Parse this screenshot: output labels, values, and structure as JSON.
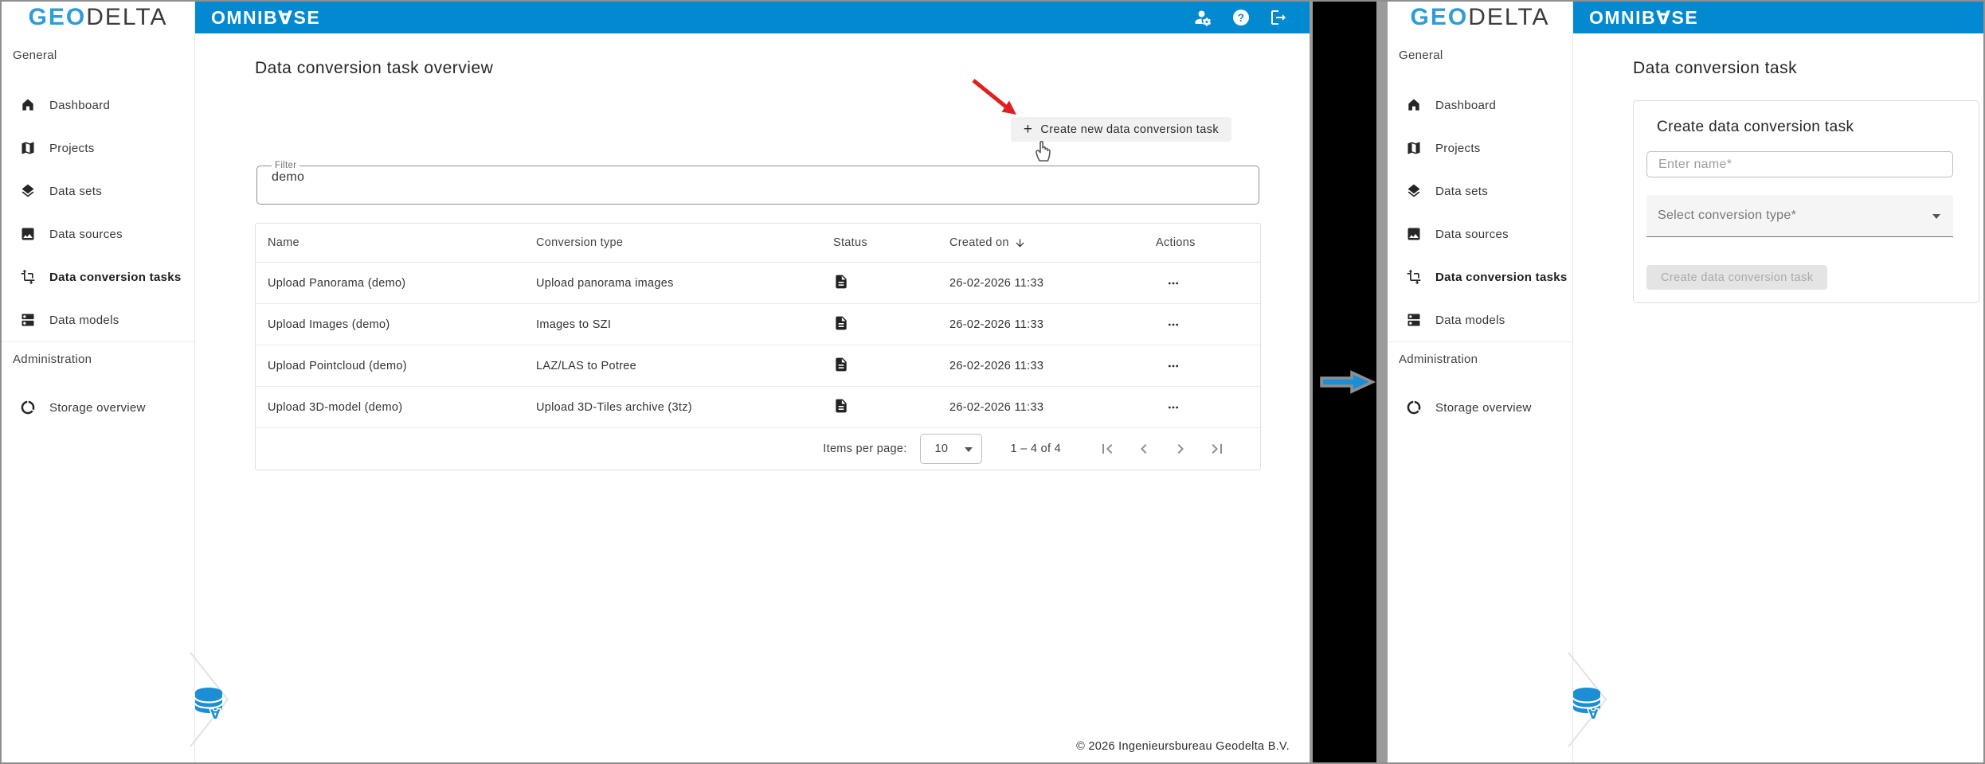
{
  "brand": {
    "logo_geo": "GEO",
    "logo_delta": "DELTA",
    "app_pre": "OMNIB",
    "app_a": "∀",
    "app_post": "SE",
    "colors": {
      "topbar_blue": "#0289d0",
      "logo_blue": "#2d9dd8",
      "accent_blue": "#1b8ed6",
      "annotation_red": "#e02020"
    }
  },
  "sidebar": {
    "section_general": "General",
    "section_admin": "Administration",
    "items": [
      {
        "label": "Dashboard",
        "icon": "home-icon"
      },
      {
        "label": "Projects",
        "icon": "map-icon"
      },
      {
        "label": "Data sets",
        "icon": "layers-icon"
      },
      {
        "label": "Data sources",
        "icon": "image-icon"
      },
      {
        "label": "Data conversion tasks",
        "icon": "transform-icon",
        "active": true
      },
      {
        "label": "Data models",
        "icon": "dns-icon"
      }
    ],
    "admin_items": [
      {
        "label": "Storage overview",
        "icon": "data-usage-icon"
      }
    ]
  },
  "topbar": {
    "icons": [
      "manage-accounts-icon",
      "help-icon",
      "logout-icon"
    ]
  },
  "left_panel": {
    "title": "Data conversion task overview",
    "create_button": {
      "plus": "+",
      "label": "Create new data conversion task"
    },
    "filter": {
      "label": "Filter",
      "value": "demo"
    },
    "table": {
      "columns": [
        "Name",
        "Conversion type",
        "Status",
        "Created on",
        "Actions"
      ],
      "sort_column": "Created on",
      "sort_direction": "desc",
      "rows": [
        {
          "name": "Upload Panorama (demo)",
          "type": "Upload panorama images",
          "status_icon": "document-icon",
          "created": "26-02-2026 11:33"
        },
        {
          "name": "Upload Images (demo)",
          "type": "Images to SZI",
          "status_icon": "document-icon",
          "created": "26-02-2026 11:33"
        },
        {
          "name": "Upload Pointcloud (demo)",
          "type": "LAZ/LAS to Potree",
          "status_icon": "document-icon",
          "created": "26-02-2026 11:33"
        },
        {
          "name": "Upload 3D-model (demo)",
          "type": "Upload 3D-Tiles archive (3tz)",
          "status_icon": "document-icon",
          "created": "26-02-2026 11:33"
        }
      ],
      "pagination": {
        "items_per_page_label": "Items per page:",
        "items_per_page": "10",
        "range": "1 – 4 of 4"
      }
    },
    "footer": "© 2026 Ingenieursbureau Geodelta B.V."
  },
  "right_panel": {
    "title": "Data conversion task",
    "card": {
      "heading": "Create data conversion task",
      "name_placeholder": "Enter name*",
      "type_placeholder": "Select conversion type*",
      "submit_label": "Create data conversion task"
    }
  }
}
